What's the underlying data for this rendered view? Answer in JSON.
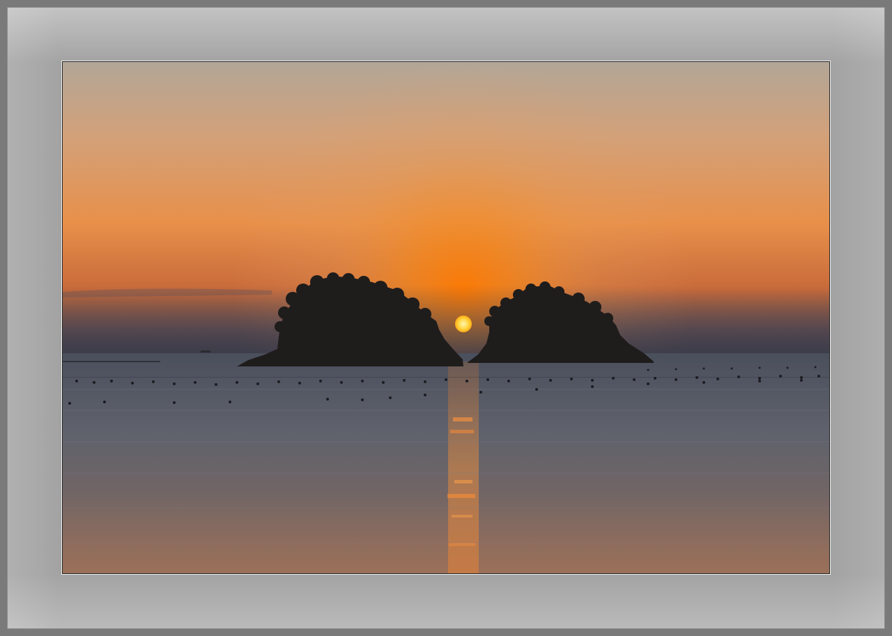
{
  "scene": {
    "subject": "sunset-over-sea-with-two-islands",
    "colors": {
      "sky_top": "#b3a596",
      "sky_mid": "#d9a26e",
      "sky_glow": "#f08a24",
      "horizon_haze": "#4a4550",
      "sun": "#ffd040",
      "sea": "#5b5e68",
      "sea_reflection": "#c8743c",
      "island": "#1e1c1c",
      "frame": "#a3a3a3"
    }
  }
}
